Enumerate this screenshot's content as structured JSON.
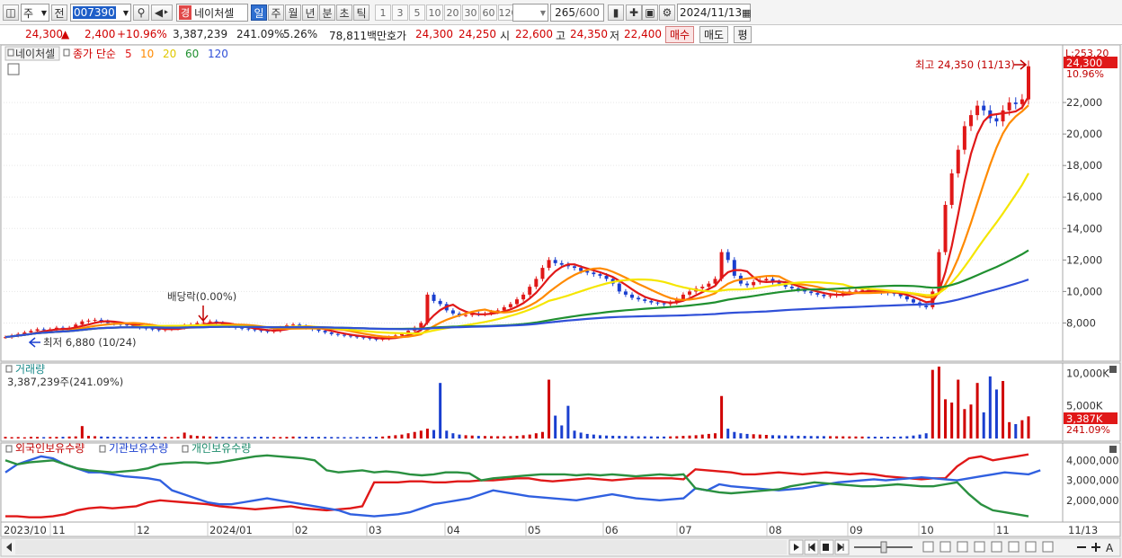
{
  "toolbar": {
    "type_label": "주",
    "prev_label": "전",
    "code": "007390",
    "market_badge": "경",
    "stock_name": "네이처셀",
    "periods": [
      "일",
      "주",
      "월",
      "년",
      "분",
      "초",
      "틱"
    ],
    "active_period": "일",
    "intervals": [
      "1",
      "3",
      "5",
      "10",
      "20",
      "30",
      "60",
      "120"
    ],
    "count_value": "265",
    "count_total": "/600",
    "date_value": "2024/11/13"
  },
  "quote": {
    "price": "24,300",
    "change": "2,400",
    "change_pct": "+10.96%",
    "volume": "3,387,239",
    "volume_ratio": "241.09%",
    "turnover": "5.26%",
    "amount": "78,811백만",
    "bid_label": "호가",
    "ask_price": "24,300",
    "bid_price": "24,250",
    "open_label": "시",
    "open": "22,600",
    "high_label": "고",
    "high": "24,350",
    "low_label": "저",
    "low": "22,400",
    "buy_button": "매수",
    "sell_button": "매도",
    "eval_button": "평"
  },
  "chart_data": {
    "type": "line",
    "price_panel": {
      "stock": "네이처셀",
      "legend_prefix": "종가 단순",
      "ma_periods": [
        "5",
        "10",
        "20",
        "60",
        "120"
      ],
      "ma_colors": [
        "#e01818",
        "#ff8a00",
        "#f5e600",
        "#209030",
        "#3050d8"
      ],
      "y_ticks": [
        8000,
        10000,
        12000,
        14000,
        16000,
        18000,
        20000,
        22000
      ],
      "y_tick_labels": [
        "8,000",
        "10,000",
        "12,000",
        "14,000",
        "16,000",
        "18,000",
        "20,000",
        "22,000"
      ],
      "ylim": [
        5800,
        25200
      ],
      "top_label": "L:253.20",
      "current_price_label": "24,300",
      "current_pct_label": "10.96%",
      "high_annotation": "최고 24,350 (11/13)",
      "low_annotation": "최저 6,880 (10/24)",
      "dividend_annotation": "배당락(0.00%)",
      "close": [
        7100,
        7200,
        7300,
        7400,
        7500,
        7600,
        7550,
        7600,
        7700,
        7650,
        7700,
        7900,
        8100,
        8150,
        8200,
        8100,
        8000,
        7950,
        7900,
        7850,
        7800,
        7700,
        7650,
        7600,
        7550,
        7600,
        7650,
        7700,
        7850,
        7900,
        8000,
        8050,
        8100,
        8000,
        7900,
        7800,
        7700,
        7650,
        7600,
        7550,
        7500,
        7450,
        7500,
        7700,
        7850,
        7900,
        7800,
        7700,
        7600,
        7500,
        7400,
        7300,
        7250,
        7200,
        7150,
        7100,
        7050,
        7000,
        6950,
        7000,
        7100,
        7200,
        7300,
        7500,
        7700,
        8000,
        9800,
        9400,
        9200,
        8800,
        8600,
        8500,
        8500,
        8600,
        8550,
        8600,
        8700,
        8800,
        9000,
        9200,
        9500,
        9800,
        10300,
        10800,
        11500,
        12000,
        11800,
        11700,
        11600,
        11500,
        11300,
        11200,
        11100,
        11000,
        10800,
        10500,
        10000,
        9800,
        9600,
        9500,
        9400,
        9300,
        9250,
        9200,
        9300,
        9500,
        9800,
        10000,
        10200,
        10300,
        10500,
        10800,
        12500,
        12000,
        11000,
        10500,
        10400,
        10600,
        10700,
        10800,
        10600,
        10500,
        10300,
        10200,
        10100,
        10000,
        9900,
        9800,
        9700,
        9750,
        9800,
        9900,
        10000,
        10050,
        10100,
        10050,
        10000,
        9950,
        9900,
        9850,
        9700,
        9500,
        9300,
        9100,
        9000,
        10000,
        12500,
        15500,
        17500,
        19000,
        20500,
        21200,
        21800,
        21500,
        21000,
        20800,
        21500,
        22000,
        21900,
        22200,
        24300
      ]
    },
    "volume_panel": {
      "title": "거래량",
      "value_label": "3,387,239주(241.09%)",
      "y_ticks": [
        "10,000K",
        "5,000K"
      ],
      "current_label": "3,387K",
      "current_pct_label": "241.09%",
      "max_volume_k": 11000,
      "values_k": [
        250,
        200,
        220,
        180,
        260,
        240,
        210,
        230,
        250,
        260,
        300,
        320,
        1900,
        400,
        350,
        300,
        280,
        260,
        250,
        240,
        230,
        220,
        260,
        280,
        250,
        240,
        230,
        260,
        900,
        500,
        400,
        350,
        300,
        280,
        260,
        250,
        240,
        230,
        220,
        250,
        260,
        240,
        230,
        220,
        250,
        300,
        280,
        270,
        260,
        250,
        240,
        230,
        220,
        210,
        200,
        230,
        240,
        250,
        260,
        300,
        400,
        500,
        600,
        800,
        1000,
        1200,
        1500,
        1300,
        8500,
        1200,
        800,
        600,
        500,
        450,
        400,
        380,
        360,
        350,
        340,
        360,
        400,
        500,
        600,
        800,
        1000,
        9000,
        3500,
        2000,
        5000,
        1200,
        900,
        700,
        600,
        500,
        450,
        420,
        400,
        380,
        360,
        340,
        330,
        320,
        310,
        300,
        320,
        350,
        400,
        450,
        500,
        600,
        700,
        800,
        6500,
        1500,
        1000,
        800,
        700,
        650,
        600,
        550,
        500,
        480,
        460,
        440,
        420,
        400,
        380,
        370,
        360,
        350,
        340,
        330,
        320,
        310,
        300,
        290,
        280,
        270,
        260,
        270,
        300,
        350,
        450,
        600,
        800,
        10500,
        11000,
        6000,
        5500,
        9000,
        4500,
        5200,
        8500,
        4000,
        9500,
        7500,
        8800,
        2500,
        2200,
        2800,
        3387
      ]
    },
    "holdings_panel": {
      "series_names": [
        "외국인보유수량",
        "기관보유수량",
        "개인보유수량"
      ],
      "series_colors": [
        "#e01818",
        "#3060e0",
        "#2a9040"
      ],
      "y_ticks": [
        4000000,
        3000000,
        2000000
      ],
      "y_tick_labels": [
        "4,000,000",
        "3,000,000",
        "2,000,000"
      ],
      "ylim": [
        1000000,
        4600000
      ],
      "foreign": [
        1200000,
        1200000,
        1150000,
        1150000,
        1200000,
        1300000,
        1500000,
        1600000,
        1650000,
        1600000,
        1650000,
        1700000,
        1900000,
        2000000,
        1950000,
        1900000,
        1850000,
        1800000,
        1700000,
        1650000,
        1600000,
        1550000,
        1600000,
        1650000,
        1700000,
        1600000,
        1550000,
        1500000,
        1550000,
        1600000,
        1700000,
        2900000,
        2900000,
        2900000,
        2950000,
        2950000,
        2900000,
        2900000,
        2950000,
        2950000,
        3000000,
        3000000,
        3050000,
        3100000,
        3100000,
        3000000,
        2950000,
        3000000,
        3050000,
        3100000,
        3050000,
        3000000,
        3050000,
        3100000,
        3100000,
        3100000,
        3100000,
        3050000,
        3550000,
        3500000,
        3450000,
        3400000,
        3300000,
        3300000,
        3350000,
        3400000,
        3350000,
        3300000,
        3350000,
        3400000,
        3350000,
        3300000,
        3350000,
        3300000,
        3200000,
        3150000,
        3100000,
        3050000,
        3100000,
        3100000,
        3700000,
        4100000,
        4200000,
        4000000,
        4100000,
        4200000,
        4300000
      ],
      "institution": [
        3400000,
        3800000,
        4000000,
        4200000,
        4100000,
        3800000,
        3600000,
        3400000,
        3400000,
        3300000,
        3200000,
        3150000,
        3100000,
        3000000,
        2500000,
        2300000,
        2100000,
        1900000,
        1800000,
        1800000,
        1900000,
        2000000,
        2100000,
        2000000,
        1900000,
        1800000,
        1700000,
        1600000,
        1500000,
        1300000,
        1250000,
        1200000,
        1250000,
        1300000,
        1400000,
        1600000,
        1800000,
        1900000,
        2000000,
        2100000,
        2300000,
        2500000,
        2400000,
        2300000,
        2200000,
        2150000,
        2100000,
        2050000,
        2000000,
        2100000,
        2200000,
        2300000,
        2200000,
        2100000,
        2050000,
        2000000,
        2050000,
        2100000,
        2600000,
        2500000,
        2800000,
        2700000,
        2650000,
        2600000,
        2550000,
        2500000,
        2550000,
        2600000,
        2700000,
        2800000,
        2900000,
        2950000,
        3000000,
        3050000,
        3000000,
        3050000,
        3100000,
        3150000,
        3100000,
        3050000,
        3000000,
        3100000,
        3200000,
        3300000,
        3400000,
        3350000,
        3300000,
        3500000
      ],
      "individual": [
        4000000,
        3800000,
        3900000,
        3950000,
        4000000,
        3800000,
        3600000,
        3500000,
        3450000,
        3400000,
        3450000,
        3500000,
        3600000,
        3800000,
        3850000,
        3900000,
        3900000,
        3850000,
        3900000,
        4000000,
        4100000,
        4200000,
        4250000,
        4200000,
        4150000,
        4100000,
        4000000,
        3500000,
        3400000,
        3450000,
        3500000,
        3400000,
        3450000,
        3400000,
        3300000,
        3250000,
        3300000,
        3400000,
        3400000,
        3350000,
        3000000,
        3100000,
        3150000,
        3200000,
        3250000,
        3300000,
        3300000,
        3300000,
        3250000,
        3300000,
        3250000,
        3300000,
        3250000,
        3200000,
        3250000,
        3300000,
        3250000,
        3300000,
        2600000,
        2500000,
        2400000,
        2350000,
        2400000,
        2450000,
        2500000,
        2550000,
        2700000,
        2800000,
        2900000,
        2850000,
        2800000,
        2750000,
        2700000,
        2700000,
        2750000,
        2800000,
        2750000,
        2700000,
        2700000,
        2800000,
        2900000,
        2300000,
        1800000,
        1500000,
        1400000,
        1300000,
        1200000
      ]
    },
    "x_tick_labels": [
      "2023/10",
      "11",
      "12",
      "2024/01",
      "02",
      "03",
      "04",
      "05",
      "06",
      "07",
      "08",
      "09",
      "10",
      "11",
      "11/13"
    ]
  }
}
